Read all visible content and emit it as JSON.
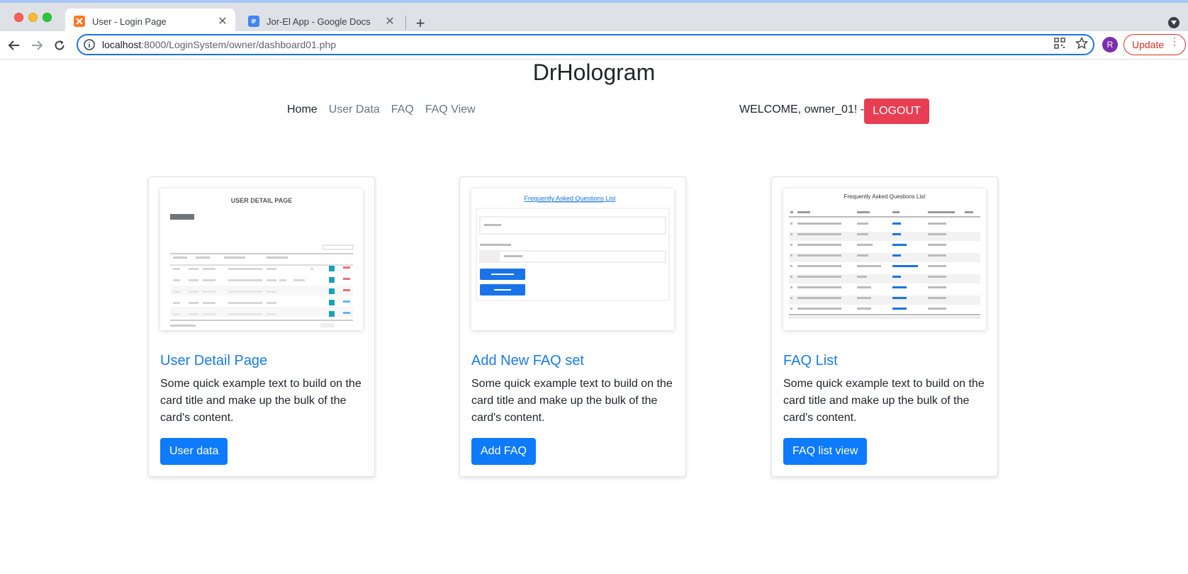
{
  "browser": {
    "tabs": [
      {
        "title": "User - Login Page",
        "active": true,
        "icon": "xampp-icon"
      },
      {
        "title": "Jor-El App - Google Docs",
        "active": false,
        "icon": "google-docs-icon"
      }
    ],
    "url_host": "localhost",
    "url_rest": ":8000/LoginSystem/owner/dashboard01.php",
    "profile_initial": "R",
    "update_label": "Update"
  },
  "page": {
    "brand": "DrHologram",
    "nav": [
      "Home",
      "User Data",
      "FAQ",
      "FAQ View"
    ],
    "welcome": "WELCOME, owner_01! -",
    "logout_label": "LOGOUT",
    "accent": "#0d7bfb",
    "danger": "#e83e54"
  },
  "cards": [
    {
      "title": "User Detail Page",
      "text": "Some quick example text to build on the card title and make up the bulk of the card's content.",
      "button": "User data",
      "thumb_heading": "USER DETAIL PAGE"
    },
    {
      "title": "Add New FAQ set",
      "text": "Some quick example text to build on the card title and make up the bulk of the card's content.",
      "button": "Add FAQ",
      "thumb_heading": "Frequently Asked Questions List"
    },
    {
      "title": "FAQ List",
      "text": "Some quick example text to build on the card title and make up the bulk of the card's content.",
      "button": "FAQ list view",
      "thumb_heading": "Frequently Asked Questions List"
    }
  ]
}
